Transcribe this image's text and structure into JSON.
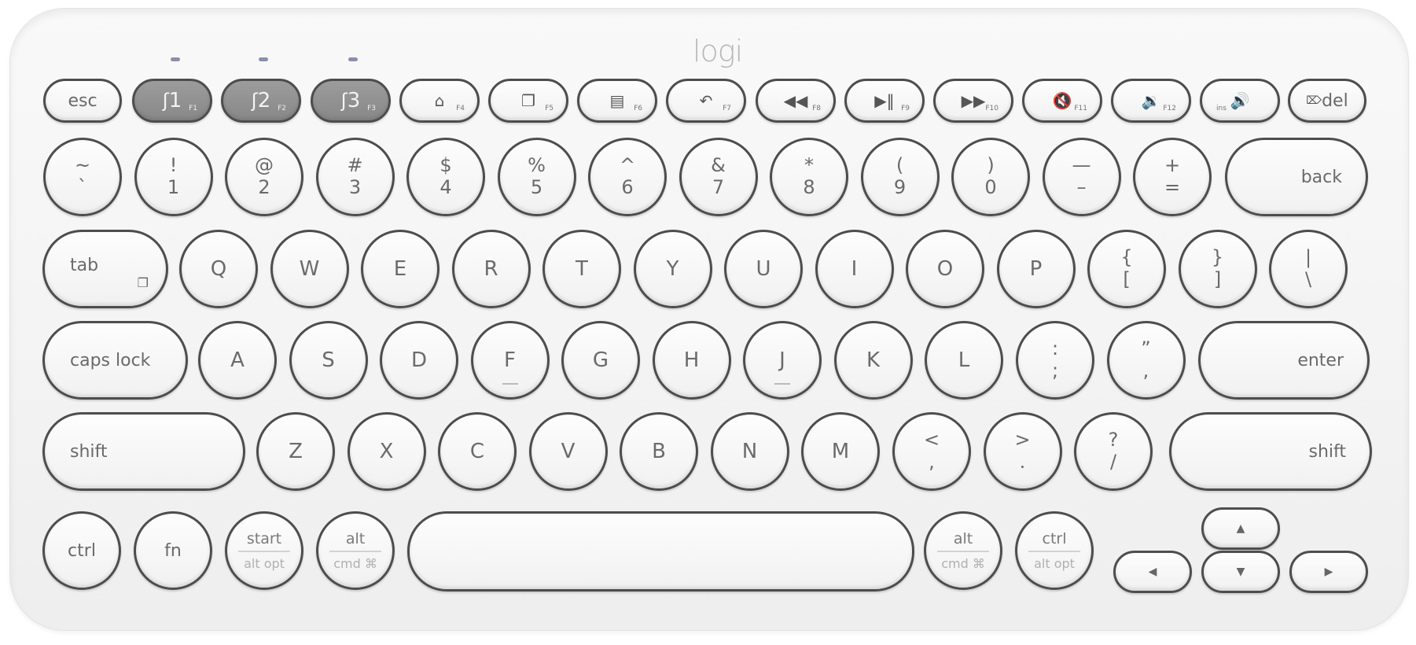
{
  "brand": {
    "logo_text": "logi"
  },
  "function_row": [
    {
      "id": "esc",
      "label": "esc",
      "sub": ""
    },
    {
      "id": "bt1",
      "label": "1",
      "sub": "F1",
      "icon": "bluetooth-icon",
      "glyph": "ʃ"
    },
    {
      "id": "bt2",
      "label": "2",
      "sub": "F2",
      "icon": "bluetooth-icon",
      "glyph": "ʃ"
    },
    {
      "id": "bt3",
      "label": "3",
      "sub": "F3",
      "icon": "bluetooth-icon",
      "glyph": "ʃ"
    },
    {
      "id": "f4",
      "label": "",
      "sub": "F4",
      "icon": "home-icon",
      "glyph": "⌂"
    },
    {
      "id": "f5",
      "label": "",
      "sub": "F5",
      "icon": "app-switch-icon",
      "glyph": "❐"
    },
    {
      "id": "f6",
      "label": "",
      "sub": "F6",
      "icon": "menu-icon",
      "glyph": "▤"
    },
    {
      "id": "f7",
      "label": "",
      "sub": "F7",
      "icon": "back-icon",
      "glyph": "↶"
    },
    {
      "id": "f8",
      "label": "",
      "sub": "F8",
      "icon": "rewind-icon",
      "glyph": "◀◀"
    },
    {
      "id": "f9",
      "label": "",
      "sub": "F9",
      "icon": "play-pause-icon",
      "glyph": "▶‖"
    },
    {
      "id": "f10",
      "label": "",
      "sub": "F10",
      "icon": "fast-forward-icon",
      "glyph": "▶▶"
    },
    {
      "id": "f11",
      "label": "",
      "sub": "F11",
      "icon": "mute-icon",
      "glyph": "🔇"
    },
    {
      "id": "f12",
      "label": "",
      "sub": "F12",
      "icon": "volume-down-icon",
      "glyph": "🔉"
    },
    {
      "id": "ins",
      "label": "",
      "sub": "ins",
      "icon": "volume-up-icon",
      "glyph": "🔊"
    },
    {
      "id": "del",
      "label": "del",
      "sub": "",
      "icon": "delete-icon",
      "glyph": "⌦"
    }
  ],
  "number_row": [
    {
      "top": "~",
      "bottom": "`"
    },
    {
      "top": "!",
      "bottom": "1"
    },
    {
      "top": "@",
      "bottom": "2"
    },
    {
      "top": "#",
      "bottom": "3"
    },
    {
      "top": "$",
      "bottom": "4"
    },
    {
      "top": "%",
      "bottom": "5"
    },
    {
      "top": "^",
      "bottom": "6"
    },
    {
      "top": "&",
      "bottom": "7"
    },
    {
      "top": "*",
      "bottom": "8"
    },
    {
      "top": "(",
      "bottom": "9"
    },
    {
      "top": ")",
      "bottom": "0"
    },
    {
      "top": "—",
      "bottom": "–"
    },
    {
      "top": "+",
      "bottom": "="
    }
  ],
  "back_label": "back",
  "tab_label": "tab",
  "qwerty_row": [
    "Q",
    "W",
    "E",
    "R",
    "T",
    "Y",
    "U",
    "I",
    "O",
    "P"
  ],
  "bracket_keys": [
    {
      "top": "{",
      "bottom": "["
    },
    {
      "top": "}",
      "bottom": "]"
    },
    {
      "top": "|",
      "bottom": "\\"
    }
  ],
  "caps_label": "caps lock",
  "home_row": [
    "A",
    "S",
    "D",
    "F",
    "G",
    "H",
    "J",
    "K",
    "L"
  ],
  "home_punct": [
    {
      "top": ":",
      "bottom": ";"
    },
    {
      "top": "”",
      "bottom": ","
    }
  ],
  "enter_label": "enter",
  "shift_label": "shift",
  "bottom_letters": [
    "Z",
    "X",
    "C",
    "V",
    "B",
    "N",
    "M"
  ],
  "bottom_punct": [
    {
      "top": "<",
      "bottom": ","
    },
    {
      "top": ">",
      "bottom": "."
    },
    {
      "top": "?",
      "bottom": "/"
    }
  ],
  "modifiers": {
    "ctrl": "ctrl",
    "fn": "fn",
    "start": {
      "top": "start",
      "bottom": "alt opt"
    },
    "alt_left": {
      "top": "alt",
      "bottom": "cmd ⌘"
    },
    "alt_right": {
      "top": "alt",
      "bottom": "cmd ⌘"
    },
    "ctrl_right": {
      "top": "ctrl",
      "bottom": "alt opt"
    }
  },
  "arrows": {
    "up": "▲",
    "down": "▼",
    "left": "◀",
    "right": "▶"
  }
}
